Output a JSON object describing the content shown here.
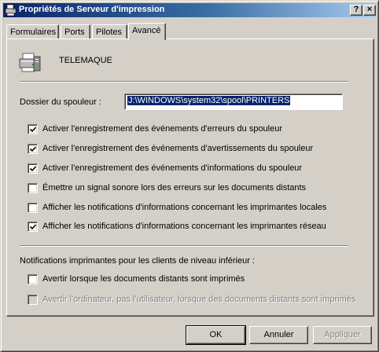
{
  "window": {
    "title": "Propriétés de Serveur d'impression",
    "help_label": "?",
    "close_label": "×"
  },
  "tabs": [
    {
      "label": "Formulaires"
    },
    {
      "label": "Ports"
    },
    {
      "label": "Pilotes"
    },
    {
      "label": "Avancé",
      "active": true
    }
  ],
  "server": {
    "name": "TELEMAQUE",
    "icon": "print-server-icon"
  },
  "spooler": {
    "label": "Dossier du spouleur :",
    "value": "J:\\WINDOWS\\system32\\spool\\PRINTERS"
  },
  "options": [
    {
      "label": "Activer l'enregistrement des événements d'erreurs du spouleur",
      "checked": true,
      "enabled": true
    },
    {
      "label": "Activer l'enregistrement des événements d'avertissements du spouleur",
      "checked": true,
      "enabled": true
    },
    {
      "label": "Activer l'enregistrement des événements d'informations du spouleur",
      "checked": true,
      "enabled": true
    },
    {
      "label": "Émettre un signal sonore lors des erreurs sur les documents distants",
      "checked": false,
      "enabled": true
    },
    {
      "label": "Afficher les notifications d'informations concernant les imprimantes locales",
      "checked": false,
      "enabled": true
    },
    {
      "label": "Afficher les notifications d'informations concernant les imprimantes réseau",
      "checked": true,
      "enabled": true
    }
  ],
  "downlevel": {
    "label": "Notifications imprimantes pour les clients de niveau inférieur :",
    "options": [
      {
        "label": "Avertir lorsque les documents distants sont imprimés",
        "checked": false,
        "enabled": true
      },
      {
        "label": "Avertir l'ordinateur, pas l'utilisateur, lorsque des documents distants sont imprimés",
        "checked": false,
        "enabled": false
      }
    ]
  },
  "buttons": {
    "ok": "OK",
    "cancel": "Annuler",
    "apply": "Appliquer"
  },
  "colors": {
    "face": "#d4d0c8",
    "title_start": "#0a246a",
    "title_end": "#a6caf0",
    "selection": "#0a246a"
  }
}
